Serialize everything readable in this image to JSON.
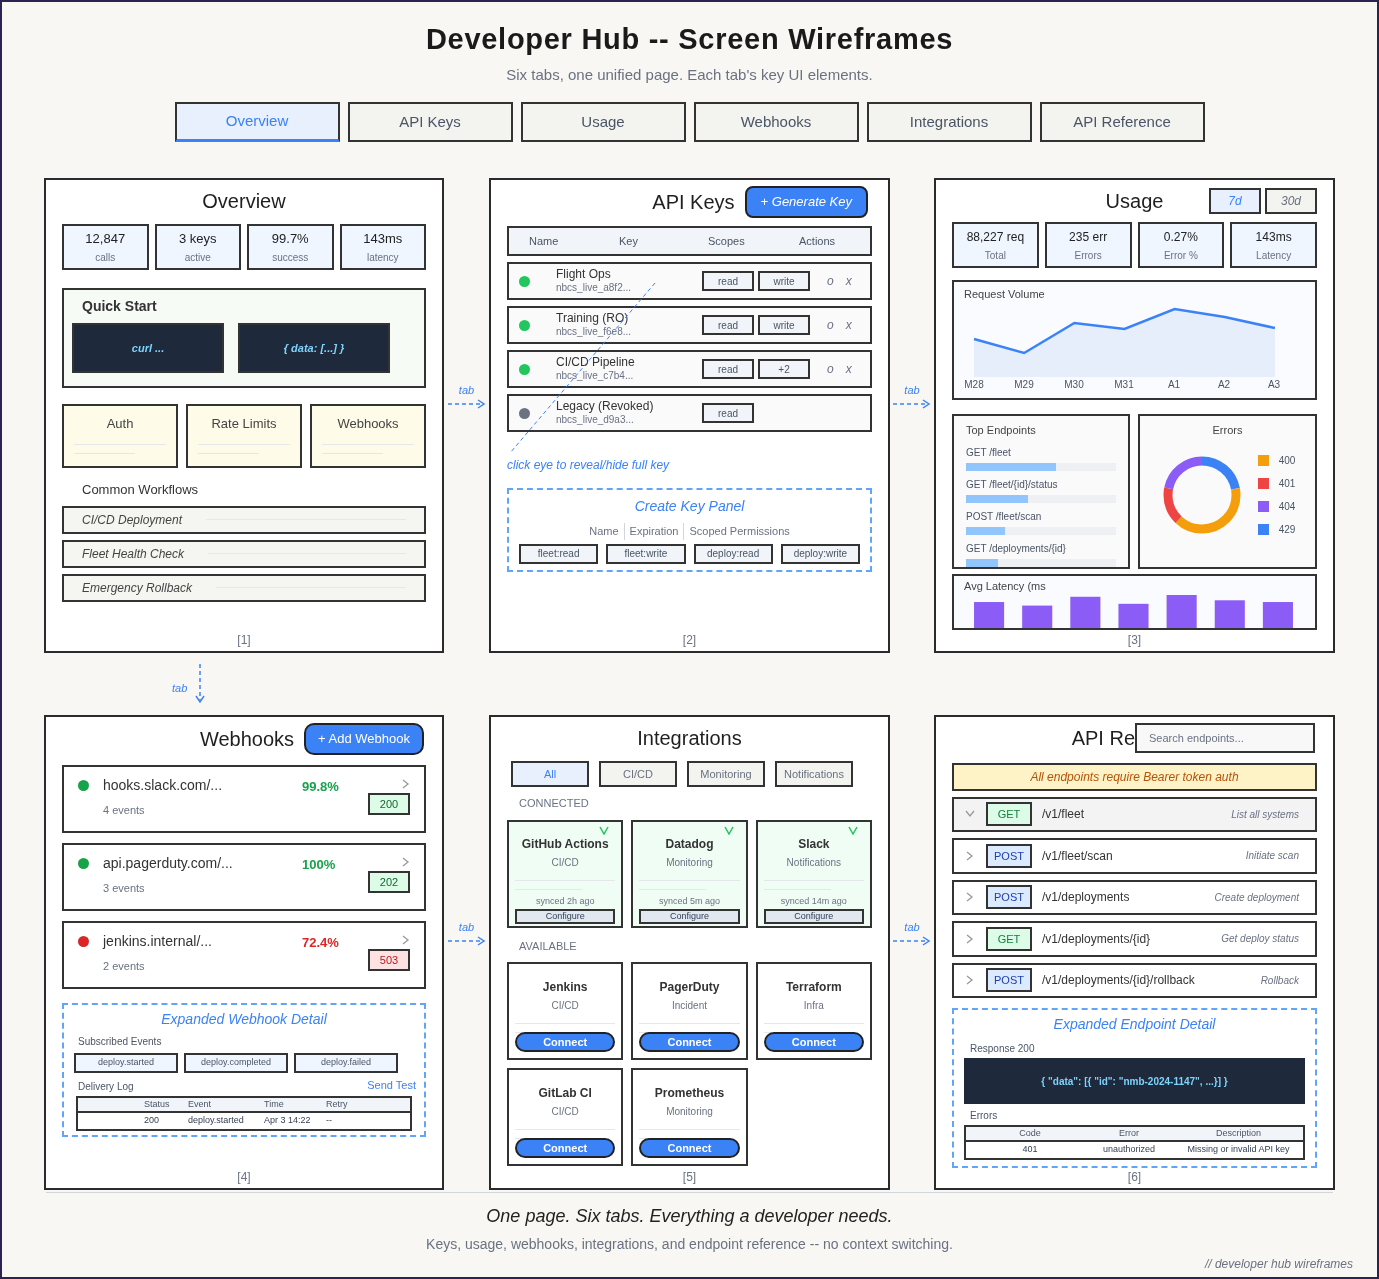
{
  "header": {
    "title": "Developer Hub -- Screen Wireframes",
    "subtitle": "Six tabs, one unified page. Each tab's key UI elements."
  },
  "tabs": [
    {
      "label": "Overview",
      "selected": true
    },
    {
      "label": "API Keys",
      "selected": false
    },
    {
      "label": "Usage",
      "selected": false
    },
    {
      "label": "Webhooks",
      "selected": false
    },
    {
      "label": "Integrations",
      "selected": false
    },
    {
      "label": "API Reference",
      "selected": false
    }
  ],
  "connectors": [
    {
      "label": "tab"
    },
    {
      "label": "tab"
    },
    {
      "label": "tab"
    },
    {
      "label": "tab"
    },
    {
      "label": "tab"
    }
  ],
  "overview": {
    "title": "Overview",
    "stats": [
      {
        "value": "12,847",
        "label": "calls"
      },
      {
        "value": "3 keys",
        "label": "active"
      },
      {
        "value": "99.7%",
        "label": "success"
      },
      {
        "value": "143ms",
        "label": "latency"
      }
    ],
    "quick_start": {
      "title": "Quick Start",
      "snippets": [
        "curl ...",
        "{ data: [...] }"
      ]
    },
    "guides": [
      "Auth",
      "Rate Limits",
      "Webhooks"
    ],
    "workflows_title": "Common Workflows",
    "workflows": [
      "CI/CD Deployment",
      "Fleet Health Check",
      "Emergency Rollback"
    ],
    "footer": "[1]"
  },
  "api_keys": {
    "title": "API Keys",
    "button": "+ Generate Key",
    "columns": [
      "Name",
      "Key",
      "Scopes",
      "Actions"
    ],
    "rows": [
      {
        "name": "Flight Ops",
        "key": "nbcs_live_a8f2...",
        "color": "#22c55e",
        "scopes": [
          "read",
          "write"
        ],
        "actions": [
          "o",
          "x"
        ]
      },
      {
        "name": "Training (RO)",
        "key": "nbcs_live_f6e8...",
        "color": "#22c55e",
        "scopes": [
          "read",
          "write"
        ],
        "actions": [
          "o",
          "x"
        ]
      },
      {
        "name": "CI/CD Pipeline",
        "key": "nbcs_live_c7b4...",
        "color": "#22c55e",
        "scopes": [
          "read",
          "+2"
        ],
        "actions": [
          "o",
          "x"
        ]
      },
      {
        "name": "Legacy (Revoked)",
        "key": "nbcs_live_d9a3...",
        "color": "#6b7280",
        "scopes": [
          "read"
        ]
      }
    ],
    "note": "click eye to reveal/hide full key",
    "create_panel": {
      "title": "Create Key Panel",
      "fields": [
        "Name",
        "Expiration",
        "Scoped Permissions"
      ],
      "permissions": [
        "fleet:read",
        "fleet:write",
        "deploy:read",
        "deploy:write"
      ]
    },
    "footer": "[2]"
  },
  "usage": {
    "title": "Usage",
    "ranges": [
      {
        "label": "7d",
        "selected": true
      },
      {
        "label": "30d",
        "selected": false
      }
    ],
    "stats": [
      {
        "value": "88,227 req",
        "label": "Total"
      },
      {
        "value": "235 err",
        "label": "Errors"
      },
      {
        "value": "0.27%",
        "label": "Error %"
      },
      {
        "value": "143ms",
        "label": "Latency"
      }
    ],
    "request_volume": {
      "title": "Request Volume",
      "x_labels": [
        "M28",
        "M29",
        "M30",
        "M31",
        "A1",
        "A2",
        "A3"
      ]
    },
    "top_endpoints": {
      "title": "Top Endpoints",
      "items": [
        {
          "label": "GET /fleet",
          "level": 0.6
        },
        {
          "label": "GET /fleet/{id}/status",
          "level": 0.41
        },
        {
          "label": "POST /fleet/scan",
          "level": 0.26
        },
        {
          "label": "GET /deployments/{id}",
          "level": 0.21
        }
      ]
    },
    "errors": {
      "title": "Errors",
      "legend": [
        {
          "label": "400",
          "color": "#f59e0b"
        },
        {
          "label": "401",
          "color": "#ef4444"
        },
        {
          "label": "404",
          "color": "#8b5cf6"
        },
        {
          "label": "429",
          "color": "#3b82f6"
        }
      ]
    },
    "latency": {
      "title": "Avg Latency (ms"
    },
    "footer": "[3]"
  },
  "webhooks": {
    "title": "Webhooks",
    "button": "+ Add Webhook",
    "endpoints": [
      {
        "url": "hooks.slack.com/...",
        "events": "4 events",
        "rate": "99.8%",
        "code": "200",
        "color": "#16a34a",
        "healthy": true
      },
      {
        "url": "api.pagerduty.com/...",
        "events": "3 events",
        "rate": "100%",
        "code": "202",
        "color": "#16a34a",
        "healthy": true
      },
      {
        "url": "jenkins.internal/...",
        "events": "2 events",
        "rate": "72.4%",
        "code": "503",
        "color": "#dc2626",
        "healthy": false
      }
    ],
    "detail": {
      "title": "Expanded Webhook Detail",
      "events_label": "Subscribed Events",
      "events": [
        "deploy.started",
        "deploy.completed",
        "deploy.failed"
      ],
      "log_label": "Delivery Log",
      "send_test": "Send Test",
      "log_columns": [
        "Status",
        "Event",
        "Time",
        "Retry"
      ],
      "log_rows": [
        [
          "200",
          "deploy.started",
          "Apr 3 14:22",
          "--"
        ]
      ]
    },
    "footer": "[4]"
  },
  "integrations": {
    "title": "Integrations",
    "filters": [
      {
        "label": "All",
        "selected": true
      },
      {
        "label": "CI/CD",
        "selected": false
      },
      {
        "label": "Monitoring",
        "selected": false
      },
      {
        "label": "Notifications",
        "selected": false
      }
    ],
    "connected_label": "CONNECTED",
    "connected": [
      {
        "name": "GitHub Actions",
        "category": "CI/CD",
        "synced": "synced 2h ago",
        "action": "Configure"
      },
      {
        "name": "Datadog",
        "category": "Monitoring",
        "synced": "synced 5m ago",
        "action": "Configure"
      },
      {
        "name": "Slack",
        "category": "Notifications",
        "synced": "synced 14m ago",
        "action": "Configure"
      }
    ],
    "available_label": "AVAILABLE",
    "available": [
      {
        "name": "Jenkins",
        "category": "CI/CD",
        "action": "Connect"
      },
      {
        "name": "PagerDuty",
        "category": "Incident",
        "action": "Connect"
      },
      {
        "name": "Terraform",
        "category": "Infra",
        "action": "Connect"
      },
      {
        "name": "GitLab CI",
        "category": "CI/CD",
        "action": "Connect"
      },
      {
        "name": "Prometheus",
        "category": "Monitoring",
        "action": "Connect"
      }
    ],
    "footer": "[5]"
  },
  "api_reference": {
    "title": "API Re",
    "search": {
      "placeholder": "Search endpoints..."
    },
    "banner": "All endpoints require Bearer token auth",
    "endpoints": [
      {
        "method": "GET",
        "kind": "get",
        "path": "/v1/fleet",
        "description": "List all systems",
        "expanded": true
      },
      {
        "method": "POST",
        "kind": "post",
        "path": "/v1/fleet/scan",
        "description": "Initiate scan",
        "expanded": false
      },
      {
        "method": "POST",
        "kind": "post",
        "path": "/v1/deployments",
        "description": "Create deployment",
        "expanded": false
      },
      {
        "method": "GET",
        "kind": "get",
        "path": "/v1/deployments/{id}",
        "description": "Get deploy status",
        "expanded": false
      },
      {
        "method": "POST",
        "kind": "post",
        "path": "/v1/deployments/{id}/rollback",
        "description": "Rollback",
        "expanded": false
      }
    ],
    "detail": {
      "title": "Expanded Endpoint Detail",
      "response_label": "Response 200",
      "response": "{ \"data\": [{ \"id\": \"nmb-2024-1147\", ...}] }",
      "errors_label": "Errors",
      "columns": [
        "Code",
        "Error",
        "Description"
      ],
      "rows": [
        [
          "401",
          "unauthorized",
          "Missing or invalid API key"
        ]
      ]
    },
    "footer": "[6]"
  },
  "footer": {
    "tagline": "One page. Six tabs. Everything a developer needs.",
    "summary": "Keys, usage, webhooks, integrations, and endpoint reference -- no context switching.",
    "signature": "// developer hub wireframes"
  }
}
